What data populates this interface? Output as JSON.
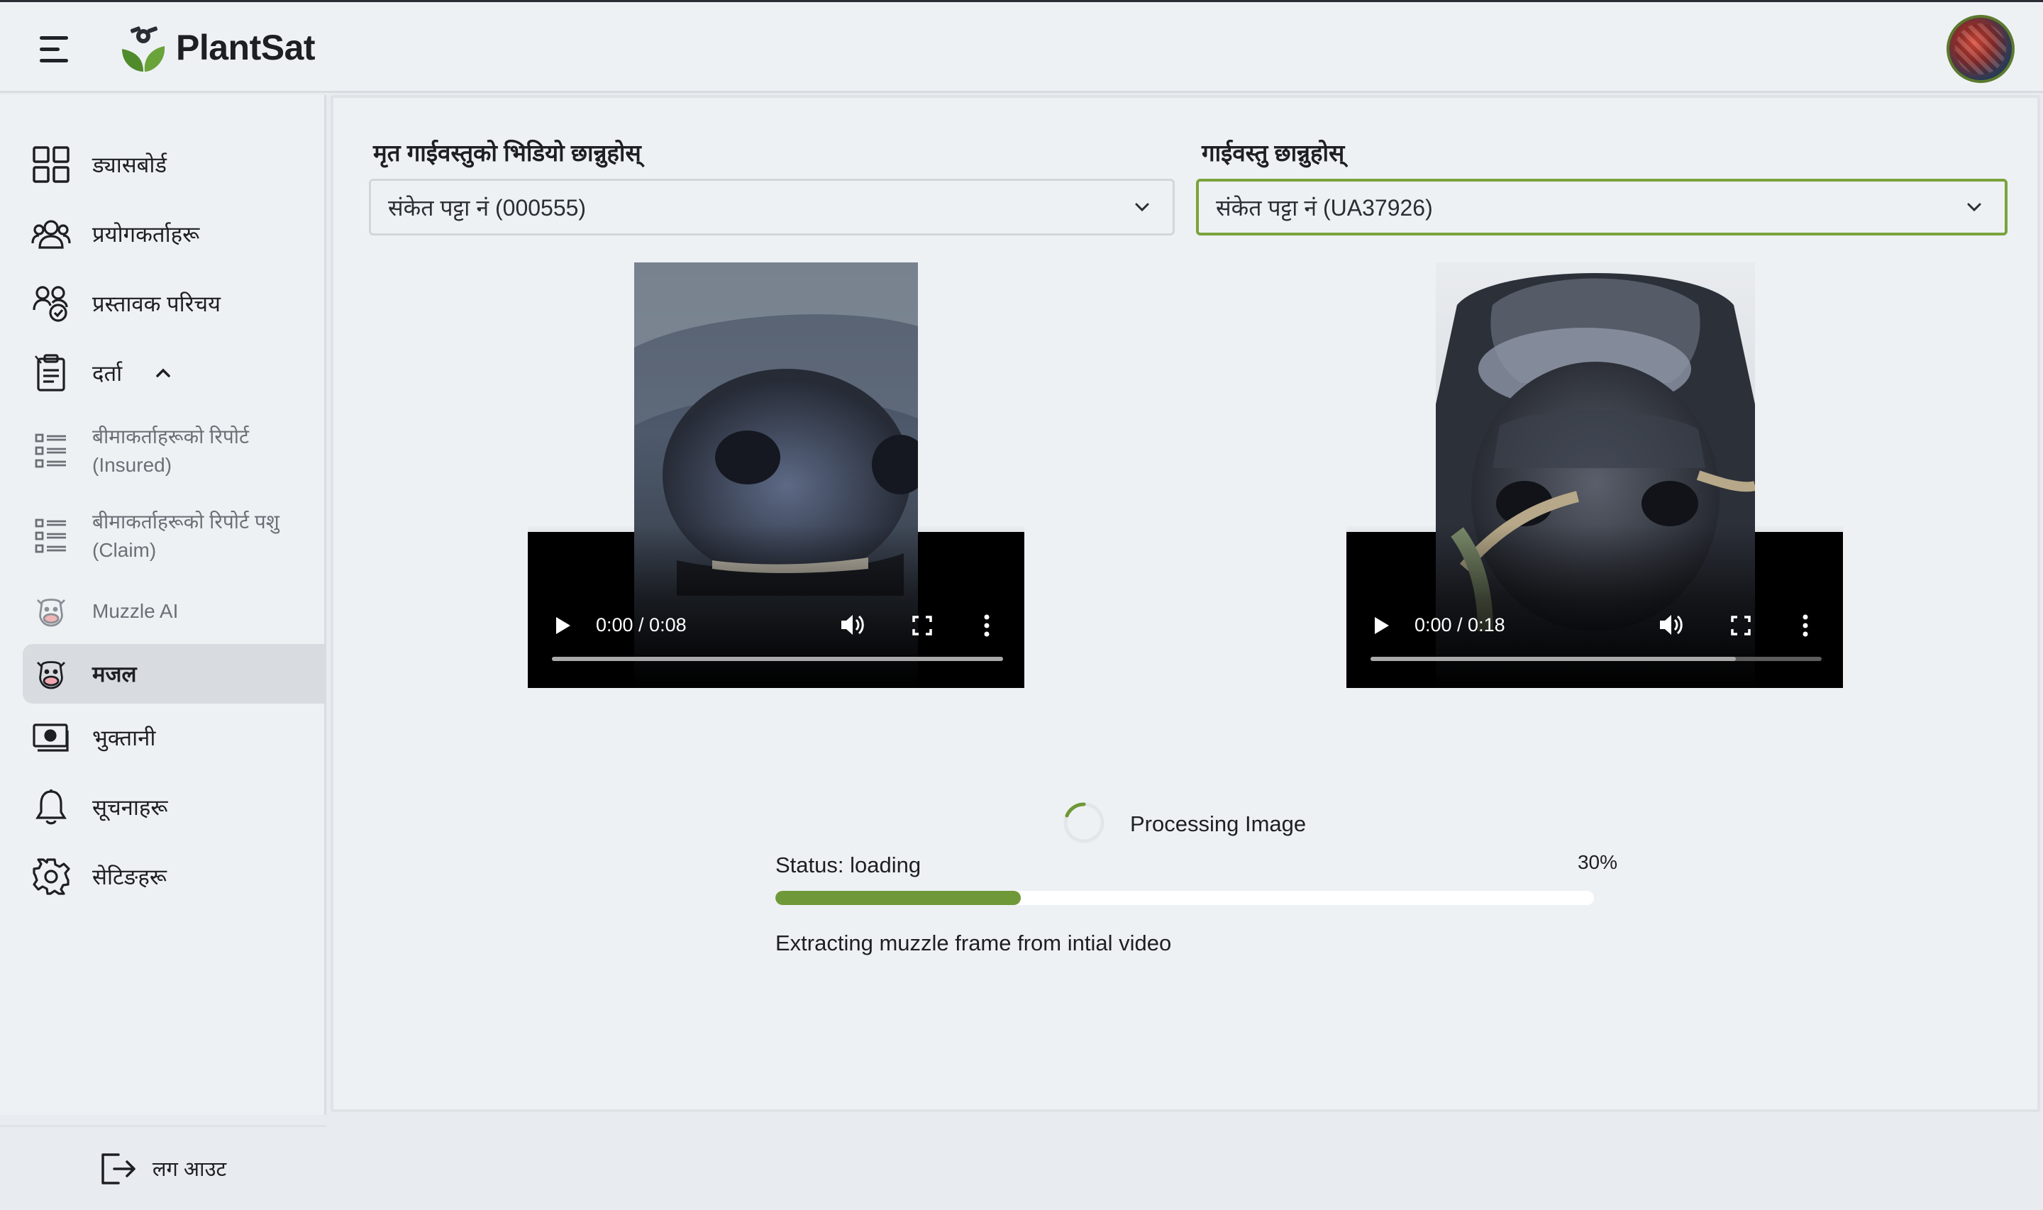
{
  "app": {
    "name": "PlantSat"
  },
  "sidebar": {
    "items": [
      {
        "label": "ड्यासबोर्ड",
        "icon": "dashboard-grid-icon"
      },
      {
        "label": "प्रयोगकर्ताहरू",
        "icon": "users-icon"
      },
      {
        "label": "प्रस्तावक परिचय",
        "icon": "proposer-group-icon"
      },
      {
        "label": "दर्ता",
        "icon": "registration-clipboard-icon",
        "expanded": true
      },
      {
        "label_line1": "बीमाकर्ताहरूको रिपोर्ट",
        "label_line2": "(Insured)",
        "icon": "report-list-icon"
      },
      {
        "label_line1": "बीमाकर्ताहरूको रिपोर्ट पशु",
        "label_line2": "(Claim)",
        "icon": "report-list-icon"
      },
      {
        "label": "Muzzle AI",
        "icon": "cow-face-icon"
      },
      {
        "label": "मजल",
        "icon": "cow-face-icon",
        "active": true
      },
      {
        "label": "भुक्तानी",
        "icon": "payment-cash-icon"
      },
      {
        "label": "सूचनाहरू",
        "icon": "bell-icon"
      },
      {
        "label": "सेटिङहरू",
        "icon": "gear-icon"
      }
    ],
    "logout_label": "लग आउट"
  },
  "form": {
    "dead_video": {
      "label": "मृत गाईवस्तुको भिडियो छान्नुहोस्",
      "value": "संकेत पट्टा नं (000555)"
    },
    "cattle": {
      "label": "गाईवस्तु छान्नुहोस्",
      "value": "संकेत पट्टा नं (UA37926)"
    }
  },
  "videos": [
    {
      "time": "0:00 / 0:08",
      "buffered_fraction": 1.0
    },
    {
      "time": "0:00 / 0:18",
      "buffered_fraction": 0.81
    }
  ],
  "processing": {
    "title": "Processing Image",
    "status": "Status: loading",
    "percent_label": "30%",
    "percent": 30,
    "message": "Extracting muzzle frame from intial video"
  },
  "colors": {
    "accent": "#6f9838",
    "focus_border": "#7aa33b",
    "active_nav": "#d8dce1"
  }
}
